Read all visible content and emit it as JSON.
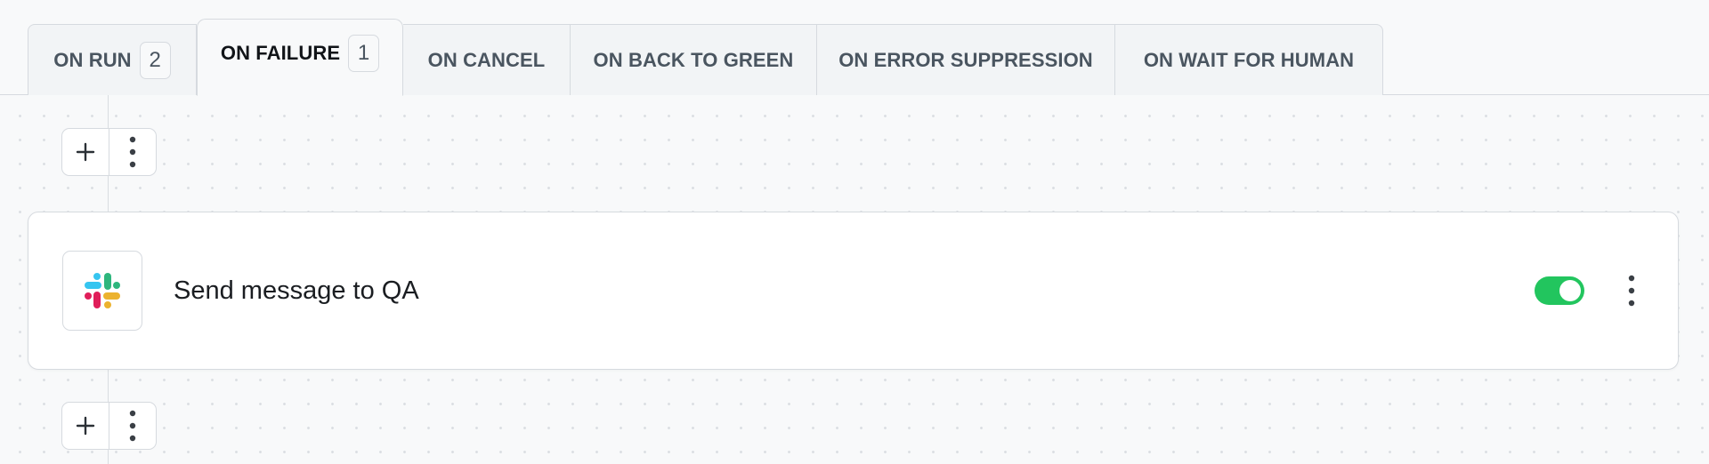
{
  "tabs": [
    {
      "label": "ON RUN",
      "count": "2",
      "active": false
    },
    {
      "label": "ON FAILURE",
      "count": "1",
      "active": true
    },
    {
      "label": "ON CANCEL",
      "active": false
    },
    {
      "label": "ON BACK TO GREEN",
      "active": false
    },
    {
      "label": "ON ERROR SUPPRESSION",
      "active": false
    },
    {
      "label": "ON WAIT FOR HUMAN",
      "active": false
    }
  ],
  "toolbar": {
    "add_icon": "plus-icon",
    "more_icon": "more-vertical-icon"
  },
  "action_card": {
    "app_icon": "slack-logo-icon",
    "title": "Send message to QA",
    "enabled": true,
    "menu_icon": "more-vertical-icon"
  },
  "colors": {
    "toggle_on": "#22c55e",
    "background": "#f8f9fa",
    "border": "#d6dadf"
  }
}
